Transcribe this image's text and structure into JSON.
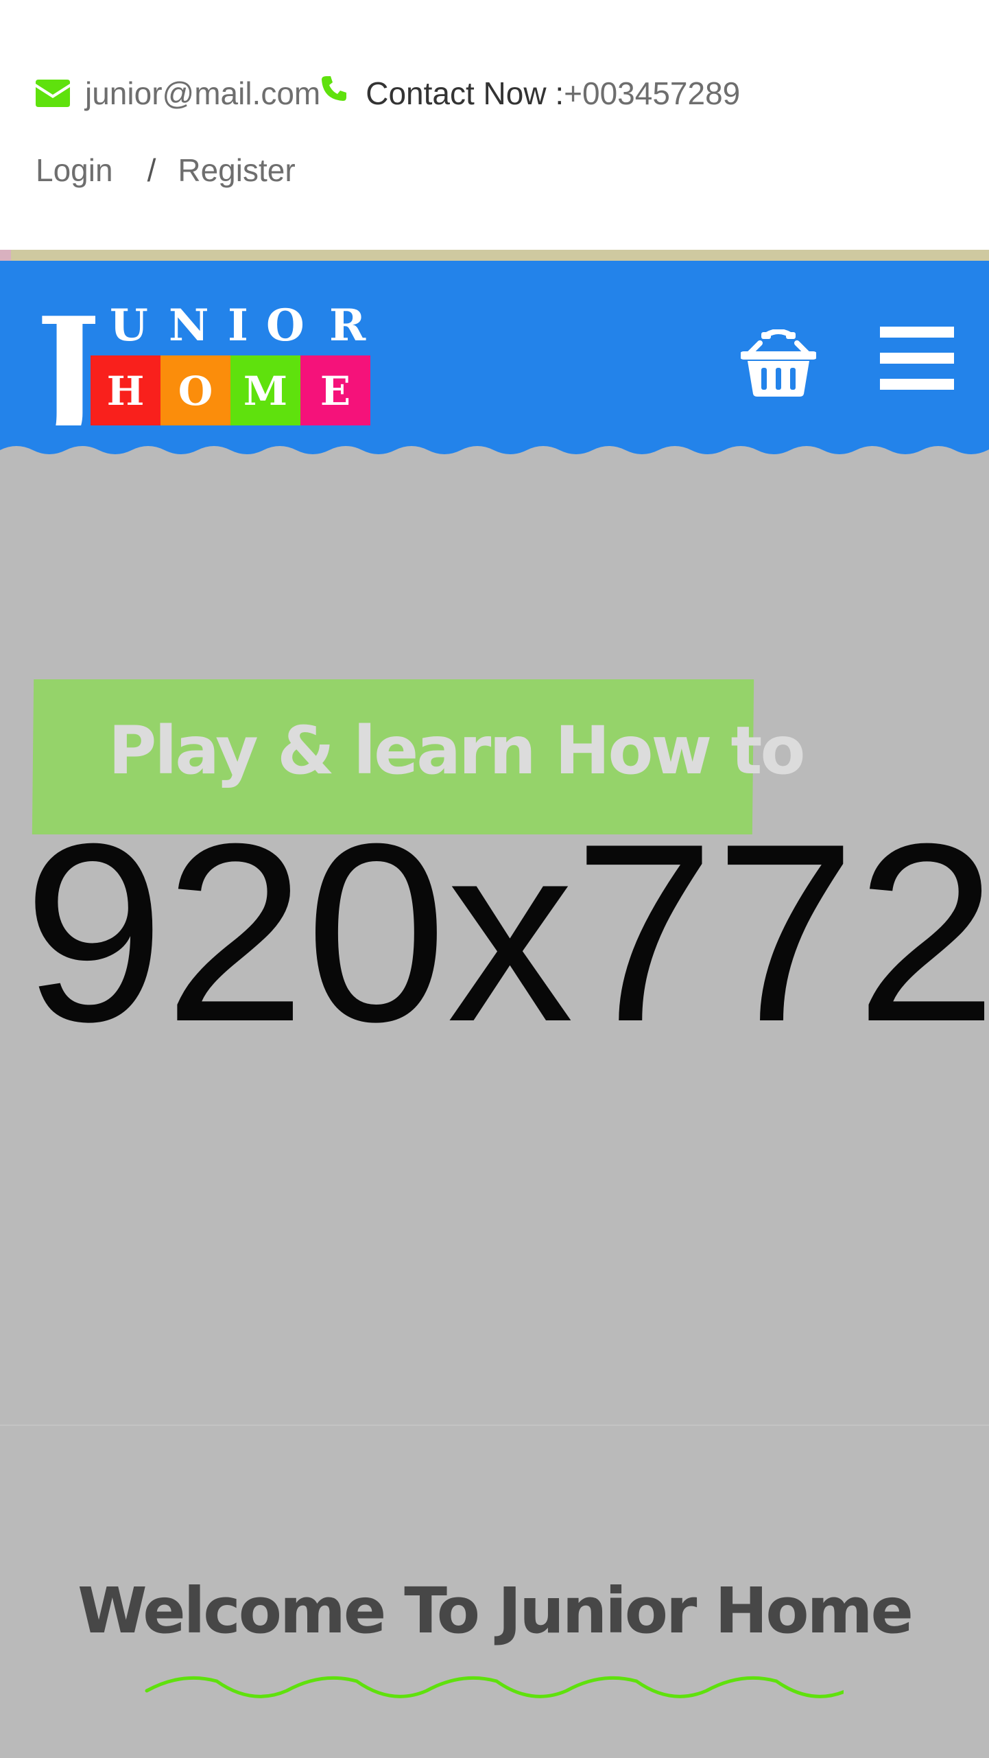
{
  "topbar": {
    "email": "junior@mail.com",
    "contact_label": "Contact Now :",
    "phone": "+003457289",
    "login": "Login",
    "separator": "/",
    "register": "Register"
  },
  "logo": {
    "top_letters": [
      "J",
      "U",
      "N",
      "I",
      "O",
      "R"
    ],
    "bottom_letters": [
      "H",
      "O",
      "M",
      "E"
    ],
    "bottom_colors": [
      "#f9201c",
      "#fb8d0b",
      "#5fe10d",
      "#f5127a"
    ]
  },
  "header": {
    "cart_icon": "shopping-basket-icon",
    "menu_icon": "hamburger-menu-icon",
    "background": "#2383ea"
  },
  "hero": {
    "tag": "Play & learn How to",
    "placeholder": "920x772"
  },
  "welcome": {
    "title": "Welcome To Junior Home"
  },
  "colors": {
    "accent_green": "#5fe10d",
    "tag_green": "#95d36a",
    "header_blue": "#2383ea"
  }
}
